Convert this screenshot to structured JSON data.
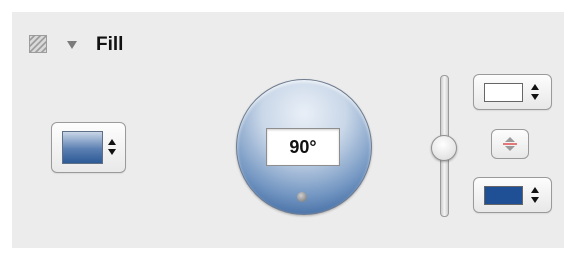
{
  "inspector": {
    "section_title": "Fill",
    "fill_style_swatch_color": "#3f6aa6",
    "angle": "90°",
    "slider_level": 0.55,
    "start_color": "#ffffff",
    "end_color": "#1f4f94"
  },
  "icons": {
    "pattern": "fill-pattern-icon",
    "disclosure": "disclosure-triangle-icon",
    "stepper": "stepper-arrows-icon",
    "swap": "swap-colors-icon"
  }
}
